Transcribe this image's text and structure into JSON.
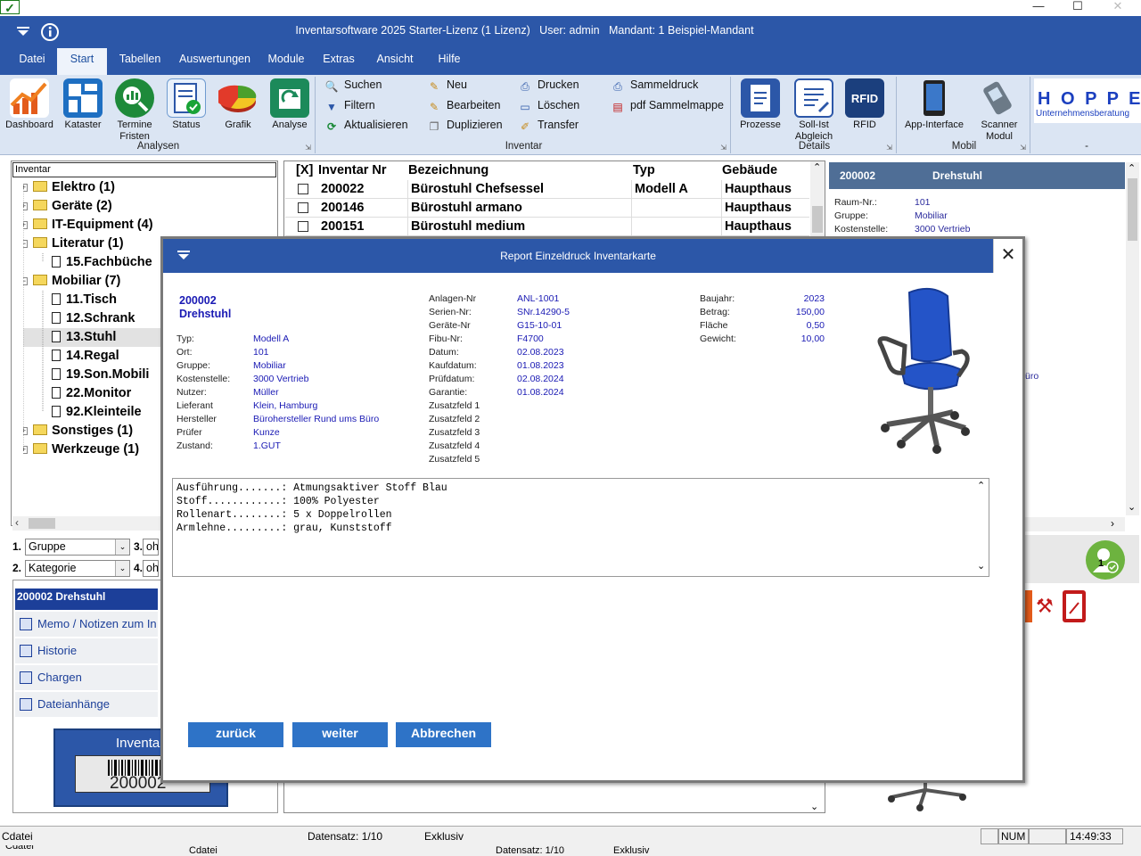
{
  "window": {
    "app_icon": "✓",
    "title": "Inventarsoftware 2025 Starter-Lizenz (1 Lizenz)   User: admin   Mandant: 1 Beispiel-Mandant",
    "minimize": "—",
    "maximize": "☐",
    "close": "✕"
  },
  "menu": {
    "tabs": [
      "Datei",
      "Start",
      "Tabellen",
      "Auswertungen",
      "Module",
      "Extras",
      "Ansicht",
      "Hilfe"
    ],
    "active": "Start"
  },
  "ribbon": {
    "analysen": {
      "label": "Analysen",
      "buttons": [
        "Dashboard",
        "Kataster",
        "Termine Fristen",
        "Status",
        "Grafik",
        "Analyse"
      ]
    },
    "inventar": {
      "label": "Inventar",
      "col1": [
        "Suchen",
        "Filtern",
        "Aktualisieren"
      ],
      "col2": [
        "Neu",
        "Bearbeiten",
        "Duplizieren"
      ],
      "col3": [
        "Drucken",
        "Löschen",
        "Transfer"
      ],
      "col4": [
        "Sammeldruck",
        "pdf Sammelmappe"
      ]
    },
    "details": {
      "label": "Details",
      "buttons": [
        "Prozesse",
        "Soll-Ist Abgleich",
        "RFID"
      ]
    },
    "mobil": {
      "label": "Mobil",
      "buttons": [
        "App-Interface",
        "Scanner Modul"
      ]
    },
    "hoppe": {
      "label": "-",
      "logo": "H O P P E",
      "sub": "Unternehmensberatung"
    }
  },
  "tree": {
    "header": "Inventar",
    "nodes": [
      {
        "label": "Elektro  (1)",
        "type": "folder",
        "expander": "+"
      },
      {
        "label": "Geräte  (2)",
        "type": "folder",
        "expander": "+"
      },
      {
        "label": "IT-Equipment  (4)",
        "type": "folder",
        "expander": "+"
      },
      {
        "label": "Literatur  (1)",
        "type": "folder-open",
        "expander": "−"
      },
      {
        "label": "15.Fachbüche",
        "type": "doc"
      },
      {
        "label": "Mobiliar  (7)",
        "type": "folder-open",
        "expander": "−"
      },
      {
        "label": "11.Tisch",
        "type": "doc"
      },
      {
        "label": "12.Schrank",
        "type": "doc"
      },
      {
        "label": "13.Stuhl",
        "type": "doc",
        "selected": true
      },
      {
        "label": "14.Regal",
        "type": "doc"
      },
      {
        "label": "19.Son.Mobili",
        "type": "doc"
      },
      {
        "label": "22.Monitor",
        "type": "doc"
      },
      {
        "label": "92.Kleinteile",
        "type": "doc"
      },
      {
        "label": "Sonstiges  (1)",
        "type": "folder",
        "expander": "+"
      },
      {
        "label": "Werkzeuge  (1)",
        "type": "folder",
        "expander": "+"
      }
    ]
  },
  "sort": {
    "n1": "1.",
    "field1": "Gruppe",
    "n2": "2.",
    "field2": "Kategorie",
    "n3": "3.",
    "field3": "oh",
    "n4": "4.",
    "field4": "oh"
  },
  "detail_nav": {
    "title": "200002 Drehstuhl",
    "items": [
      "Memo / Notizen zum In",
      "Historie",
      "Chargen",
      "Dateianhänge"
    ]
  },
  "label_preview": {
    "text": "Inventa",
    "number": "200002"
  },
  "table": {
    "headers": [
      "[X]",
      "Inventar Nr",
      "Bezeichnung",
      "Typ",
      "Gebäude"
    ],
    "rows": [
      {
        "nr": "200022",
        "bez": "Bürostuhl Chefsessel",
        "typ": "Modell A",
        "geb": "Haupthaus"
      },
      {
        "nr": "200146",
        "bez": "Bürostuhl armano",
        "typ": "",
        "geb": "Haupthaus"
      },
      {
        "nr": "200151",
        "bez": "Bürostuhl medium",
        "typ": "",
        "geb": "Haupthaus"
      }
    ]
  },
  "right_panel": {
    "nr": "200002",
    "name": "Drehstuhl",
    "fields": [
      {
        "label": "Raum-Nr.:",
        "value": "101"
      },
      {
        "label": "Gruppe:",
        "value": "Mobiliar"
      },
      {
        "label": "Kostenstelle:",
        "value": "3000 Vertrieb"
      }
    ],
    "partial": "üro",
    "avatar_badge": "1"
  },
  "modal": {
    "title": "Report Einzeldruck Inventarkarte",
    "close": "✕",
    "nr": "200002",
    "name": "Drehstuhl",
    "col1": [
      {
        "label": "Typ:",
        "value": "Modell A"
      },
      {
        "label": "Ort:",
        "value": "101"
      },
      {
        "label": "Gruppe:",
        "value": "Mobiliar"
      },
      {
        "label": "Kostenstelle:",
        "value": "3000 Vertrieb"
      },
      {
        "label": "Nutzer:",
        "value": "Müller"
      },
      {
        "label": "Lieferant",
        "value": "Klein, Hamburg"
      },
      {
        "label": "Hersteller",
        "value": "Bürohersteller Rund ums Büro"
      },
      {
        "label": "Prüfer",
        "value": "Kunze"
      },
      {
        "label": "Zustand:",
        "value": "1.GUT"
      }
    ],
    "col2": [
      {
        "label": "Anlagen-Nr",
        "value": "ANL-1001"
      },
      {
        "label": "Serien-Nr:",
        "value": "SNr.14290-5"
      },
      {
        "label": "Geräte-Nr",
        "value": "G15-10-01"
      },
      {
        "label": "Fibu-Nr:",
        "value": "F4700"
      },
      {
        "label": "Datum:",
        "value": "02.08.2023"
      },
      {
        "label": "Kaufdatum:",
        "value": "01.08.2023"
      },
      {
        "label": "Prüfdatum:",
        "value": "02.08.2024"
      },
      {
        "label": "Garantie:",
        "value": "01.08.2024"
      },
      {
        "label": "Zusatzfeld 1",
        "value": ""
      },
      {
        "label": "Zusatzfeld 2",
        "value": ""
      },
      {
        "label": "Zusatzfeld 3",
        "value": ""
      },
      {
        "label": "Zusatzfeld 4",
        "value": ""
      },
      {
        "label": "Zusatzfeld 5",
        "value": ""
      }
    ],
    "col3": [
      {
        "label": "Baujahr:",
        "value": "2023"
      },
      {
        "label": "Betrag:",
        "value": "150,00"
      },
      {
        "label": "Fläche",
        "value": "0,50"
      },
      {
        "label": "Gewicht:",
        "value": "10,00"
      }
    ],
    "memo": "Ausführung.......: Atmungsaktiver Stoff Blau\nStoff............: 100% Polyester\nRollenart........: 5 x Doppelrollen\nArmlehne.........: grau, Kunststoff",
    "buttons": {
      "back": "zurück",
      "next": "weiter",
      "cancel": "Abbrechen"
    }
  },
  "status": {
    "left": "Cdatei",
    "record": "Datensatz: 1/10",
    "mode": "Exklusiv",
    "num": "NUM",
    "time": "14:49:33",
    "left2": "Cdatei",
    "record2": "Datensatz: 1/10",
    "mode2": "Exklusiv"
  },
  "colors": {
    "header_blue": "#2c57a8",
    "ribbon": "#dbe5f3",
    "button_blue": "#2e73c7",
    "value_blue": "#1a1ab4"
  }
}
